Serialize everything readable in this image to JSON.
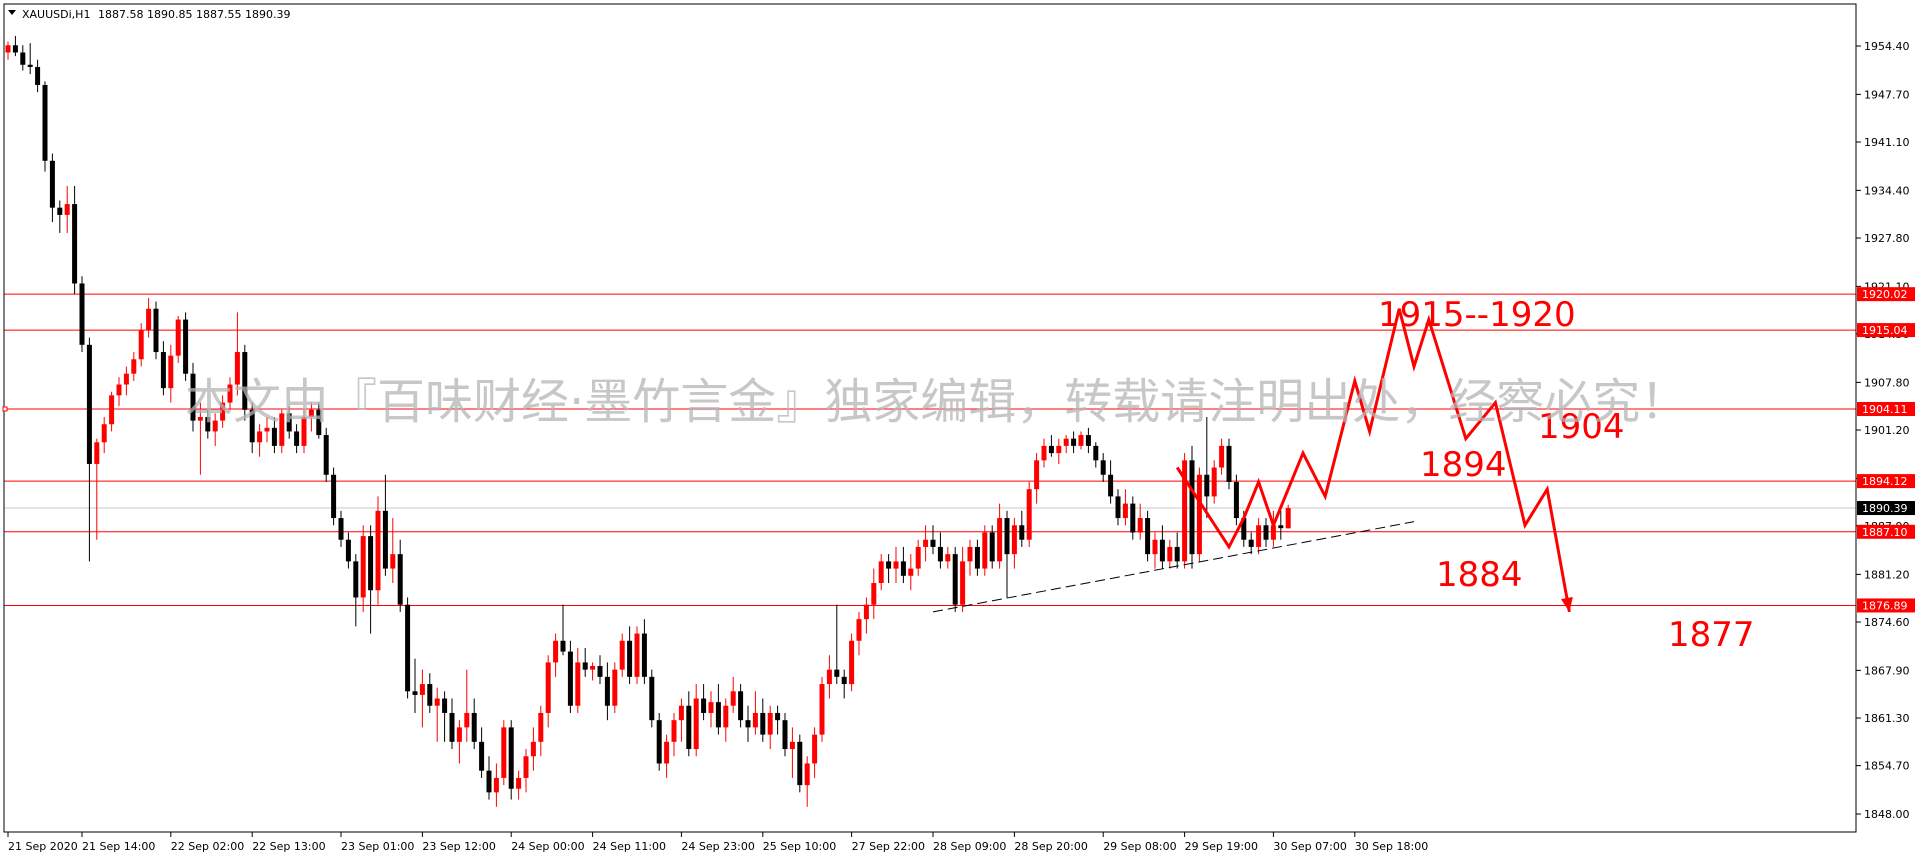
{
  "header": {
    "symbol": "XAUUSDi,H1",
    "ohlc": "1887.58 1890.85 1887.55 1890.39"
  },
  "watermark": "本文由『百味财经·墨竹言金』独家编辑，转载请注明出处，经察必究！",
  "chart_data": {
    "type": "candlestick",
    "symbol": "XAUUSDi",
    "timeframe": "H1",
    "ylim": [
      1845.0,
      1960.0
    ],
    "y_ticks": [
      1954.4,
      1947.7,
      1941.1,
      1934.4,
      1927.8,
      1921.1,
      1914.5,
      1907.8,
      1901.2,
      1894.5,
      1887.9,
      1881.2,
      1874.6,
      1867.9,
      1861.3,
      1854.7,
      1848.0
    ],
    "x_ticks": [
      "21 Sep 2020",
      "21 Sep 14:00",
      "22 Sep 02:00",
      "22 Sep 13:00",
      "23 Sep 01:00",
      "23 Sep 12:00",
      "24 Sep 00:00",
      "24 Sep 11:00",
      "24 Sep 23:00",
      "25 Sep 10:00",
      "27 Sep 22:00",
      "28 Sep 09:00",
      "28 Sep 20:00",
      "29 Sep 08:00",
      "29 Sep 19:00",
      "30 Sep 07:00",
      "30 Sep 18:00"
    ],
    "x_tick_index": [
      0,
      10,
      22,
      33,
      45,
      56,
      68,
      79,
      91,
      102,
      114,
      125,
      136,
      148,
      159,
      171,
      182
    ],
    "candles_approx": [
      [
        1953.5,
        1955.0,
        1952.5,
        1954.5
      ],
      [
        1954.5,
        1955.8,
        1953.0,
        1953.5
      ],
      [
        1953.5,
        1954.5,
        1951.0,
        1951.8
      ],
      [
        1951.8,
        1954.8,
        1950.5,
        1951.5
      ],
      [
        1951.5,
        1952.5,
        1948.0,
        1949.0
      ],
      [
        1949.0,
        1949.5,
        1937.0,
        1938.5
      ],
      [
        1938.5,
        1939.5,
        1930.0,
        1932.0
      ],
      [
        1932.0,
        1933.0,
        1928.5,
        1931.0
      ],
      [
        1931.0,
        1935.0,
        1928.5,
        1932.5
      ],
      [
        1932.5,
        1935.0,
        1920.0,
        1921.5
      ],
      [
        1921.5,
        1922.5,
        1912.0,
        1913.0
      ],
      [
        1913.0,
        1914.0,
        1883.0,
        1896.5
      ],
      [
        1896.5,
        1900.0,
        1886.0,
        1899.5
      ],
      [
        1899.5,
        1903.0,
        1898.0,
        1902.0
      ],
      [
        1902.0,
        1906.5,
        1901.0,
        1906.0
      ],
      [
        1906.0,
        1908.5,
        1904.5,
        1907.5
      ],
      [
        1907.5,
        1910.0,
        1906.0,
        1909.0
      ],
      [
        1909.0,
        1912.0,
        1908.0,
        1911.0
      ],
      [
        1911.0,
        1916.0,
        1910.0,
        1915.0
      ],
      [
        1915.0,
        1919.5,
        1914.0,
        1918.0
      ],
      [
        1918.0,
        1919.0,
        1911.0,
        1912.0
      ],
      [
        1912.0,
        1913.5,
        1906.0,
        1907.0
      ],
      [
        1907.0,
        1913.0,
        1905.0,
        1911.5
      ],
      [
        1911.5,
        1917.0,
        1910.5,
        1916.5
      ],
      [
        1916.5,
        1917.5,
        1908.0,
        1909.0
      ],
      [
        1909.0,
        1910.5,
        1901.0,
        1902.5
      ],
      [
        1902.5,
        1905.0,
        1895.0,
        1903.0
      ],
      [
        1903.0,
        1904.0,
        1900.0,
        1901.0
      ],
      [
        1901.0,
        1903.5,
        1899.0,
        1902.5
      ],
      [
        1902.5,
        1906.0,
        1901.5,
        1905.0
      ],
      [
        1905.0,
        1908.5,
        1904.0,
        1907.5
      ],
      [
        1907.5,
        1917.5,
        1906.0,
        1912.0
      ],
      [
        1912.0,
        1913.0,
        1902.5,
        1904.0
      ],
      [
        1904.0,
        1905.0,
        1898.0,
        1899.5
      ],
      [
        1899.5,
        1902.0,
        1897.5,
        1901.0
      ],
      [
        1901.0,
        1903.0,
        1899.5,
        1901.5
      ],
      [
        1901.5,
        1903.0,
        1898.0,
        1899.0
      ],
      [
        1899.0,
        1904.0,
        1898.0,
        1903.5
      ],
      [
        1903.5,
        1904.5,
        1900.0,
        1901.0
      ],
      [
        1901.0,
        1902.0,
        1898.0,
        1899.0
      ],
      [
        1899.0,
        1904.0,
        1898.0,
        1903.0
      ],
      [
        1903.0,
        1905.0,
        1901.0,
        1904.0
      ],
      [
        1904.0,
        1905.0,
        1900.0,
        1900.5
      ],
      [
        1900.5,
        1901.5,
        1894.0,
        1895.0
      ],
      [
        1895.0,
        1896.0,
        1888.0,
        1889.0
      ],
      [
        1889.0,
        1890.0,
        1885.0,
        1886.0
      ],
      [
        1886.0,
        1887.0,
        1882.0,
        1883.0
      ],
      [
        1883.0,
        1884.0,
        1874.0,
        1878.0
      ],
      [
        1878.0,
        1888.0,
        1876.0,
        1886.5
      ],
      [
        1886.5,
        1888.0,
        1873.0,
        1879.0
      ],
      [
        1879.0,
        1892.0,
        1877.0,
        1890.0
      ],
      [
        1890.0,
        1895.0,
        1881.0,
        1882.0
      ],
      [
        1882.0,
        1889.0,
        1880.0,
        1884.0
      ],
      [
        1884.0,
        1886.0,
        1876.0,
        1877.0
      ],
      [
        1877.0,
        1878.0,
        1864.0,
        1865.0
      ],
      [
        1865.0,
        1869.5,
        1862.0,
        1864.5
      ],
      [
        1864.5,
        1868.0,
        1860.0,
        1866.0
      ],
      [
        1866.0,
        1867.5,
        1862.0,
        1863.0
      ],
      [
        1863.0,
        1865.5,
        1858.0,
        1864.0
      ],
      [
        1864.0,
        1865.0,
        1858.0,
        1862.0
      ],
      [
        1862.0,
        1864.0,
        1857.0,
        1858.0
      ],
      [
        1858.0,
        1861.0,
        1855.0,
        1860.0
      ],
      [
        1860.0,
        1868.0,
        1858.0,
        1862.0
      ],
      [
        1862.0,
        1864.0,
        1857.0,
        1858.0
      ],
      [
        1858.0,
        1860.0,
        1853.0,
        1854.0
      ],
      [
        1854.0,
        1856.0,
        1850.0,
        1851.0
      ],
      [
        1851.0,
        1855.0,
        1849.0,
        1853.0
      ],
      [
        1853.0,
        1861.0,
        1852.0,
        1860.0
      ],
      [
        1860.0,
        1861.0,
        1850.0,
        1851.5
      ],
      [
        1851.5,
        1854.0,
        1850.0,
        1853.0
      ],
      [
        1853.0,
        1857.0,
        1851.0,
        1856.0
      ],
      [
        1856.0,
        1860.0,
        1854.0,
        1858.0
      ],
      [
        1858.0,
        1863.0,
        1856.0,
        1862.0
      ],
      [
        1862.0,
        1870.0,
        1860.0,
        1869.0
      ],
      [
        1869.0,
        1873.0,
        1867.0,
        1872.0
      ],
      [
        1872.0,
        1877.0,
        1870.0,
        1870.5
      ],
      [
        1870.5,
        1872.0,
        1862.0,
        1863.0
      ],
      [
        1863.0,
        1871.0,
        1862.0,
        1869.0
      ],
      [
        1869.0,
        1871.0,
        1867.0,
        1868.0
      ],
      [
        1868.0,
        1869.0,
        1866.5,
        1868.5
      ],
      [
        1868.5,
        1870.0,
        1866.0,
        1867.0
      ],
      [
        1867.0,
        1869.0,
        1861.0,
        1863.0
      ],
      [
        1863.0,
        1869.0,
        1862.0,
        1868.0
      ],
      [
        1868.0,
        1873.0,
        1867.0,
        1872.0
      ],
      [
        1872.0,
        1874.0,
        1866.0,
        1867.0
      ],
      [
        1867.0,
        1874.0,
        1866.0,
        1873.0
      ],
      [
        1873.0,
        1875.0,
        1866.0,
        1867.0
      ],
      [
        1867.0,
        1868.0,
        1860.0,
        1861.0
      ],
      [
        1861.0,
        1862.0,
        1854.0,
        1855.0
      ],
      [
        1855.0,
        1859.0,
        1853.0,
        1858.0
      ],
      [
        1858.0,
        1862.0,
        1856.0,
        1861.0
      ],
      [
        1861.0,
        1864.0,
        1858.0,
        1863.0
      ],
      [
        1863.0,
        1865.0,
        1856.0,
        1857.0
      ],
      [
        1857.0,
        1866.0,
        1856.0,
        1864.0
      ],
      [
        1864.0,
        1866.0,
        1861.0,
        1862.0
      ],
      [
        1862.0,
        1865.0,
        1860.0,
        1863.5
      ],
      [
        1863.5,
        1866.0,
        1859.0,
        1860.0
      ],
      [
        1860.0,
        1864.0,
        1858.0,
        1863.0
      ],
      [
        1863.0,
        1867.0,
        1862.0,
        1865.0
      ],
      [
        1865.0,
        1866.0,
        1860.0,
        1861.0
      ],
      [
        1861.0,
        1863.0,
        1858.0,
        1860.0
      ],
      [
        1860.0,
        1865.0,
        1859.0,
        1862.0
      ],
      [
        1862.0,
        1864.0,
        1858.0,
        1859.0
      ],
      [
        1859.0,
        1863.0,
        1857.0,
        1862.0
      ],
      [
        1862.0,
        1863.0,
        1859.0,
        1861.0
      ],
      [
        1861.0,
        1862.0,
        1856.0,
        1857.0
      ],
      [
        1857.0,
        1860.0,
        1853.0,
        1858.0
      ],
      [
        1858.0,
        1859.0,
        1851.0,
        1852.0
      ],
      [
        1852.0,
        1856.0,
        1849.0,
        1855.0
      ],
      [
        1855.0,
        1860.0,
        1853.0,
        1859.0
      ],
      [
        1859.0,
        1867.0,
        1858.0,
        1866.0
      ],
      [
        1866.0,
        1870.0,
        1864.0,
        1868.0
      ],
      [
        1868.0,
        1877.0,
        1866.0,
        1867.0
      ],
      [
        1867.0,
        1868.0,
        1864.0,
        1866.0
      ],
      [
        1866.0,
        1873.0,
        1865.0,
        1872.0
      ],
      [
        1872.0,
        1876.0,
        1870.0,
        1875.0
      ],
      [
        1875.0,
        1878.0,
        1873.0,
        1877.0
      ],
      [
        1877.0,
        1882.0,
        1875.0,
        1880.0
      ],
      [
        1880.0,
        1884.0,
        1879.0,
        1883.0
      ],
      [
        1883.0,
        1884.0,
        1880.0,
        1882.0
      ],
      [
        1882.0,
        1885.0,
        1880.0,
        1883.0
      ],
      [
        1883.0,
        1885.0,
        1880.0,
        1881.0
      ],
      [
        1881.0,
        1884.0,
        1879.0,
        1882.0
      ],
      [
        1882.0,
        1886.0,
        1881.0,
        1885.0
      ],
      [
        1885.0,
        1888.0,
        1883.0,
        1886.0
      ],
      [
        1886.0,
        1888.0,
        1884.0,
        1885.0
      ],
      [
        1885.0,
        1887.0,
        1882.0,
        1883.0
      ],
      [
        1883.0,
        1885.0,
        1882.0,
        1884.0
      ],
      [
        1884.0,
        1885.0,
        1876.0,
        1877.0
      ],
      [
        1877.0,
        1885.0,
        1876.0,
        1883.0
      ],
      [
        1883.0,
        1886.0,
        1881.0,
        1885.0
      ],
      [
        1885.0,
        1886.0,
        1881.0,
        1882.0
      ],
      [
        1882.0,
        1888.0,
        1881.0,
        1887.0
      ],
      [
        1887.0,
        1888.0,
        1882.0,
        1883.0
      ],
      [
        1883.0,
        1891.0,
        1882.0,
        1889.0
      ],
      [
        1889.0,
        1890.0,
        1878.0,
        1884.0
      ],
      [
        1884.0,
        1889.0,
        1882.0,
        1888.0
      ],
      [
        1888.0,
        1890.0,
        1885.0,
        1886.0
      ],
      [
        1886.0,
        1894.0,
        1885.0,
        1893.0
      ],
      [
        1893.0,
        1898.0,
        1891.0,
        1897.0
      ],
      [
        1897.0,
        1900.0,
        1896.0,
        1899.0
      ],
      [
        1899.0,
        1900.5,
        1897.5,
        1898.0
      ],
      [
        1898.0,
        1900.0,
        1896.5,
        1899.0
      ],
      [
        1899.0,
        1900.5,
        1898.0,
        1900.0
      ],
      [
        1900.0,
        1901.0,
        1898.0,
        1899.0
      ],
      [
        1899.0,
        1901.0,
        1898.5,
        1900.5
      ],
      [
        1900.5,
        1901.5,
        1898.0,
        1899.0
      ],
      [
        1899.0,
        1899.5,
        1896.0,
        1897.0
      ],
      [
        1897.0,
        1898.0,
        1894.0,
        1895.0
      ],
      [
        1895.0,
        1897.0,
        1891.0,
        1892.0
      ],
      [
        1892.0,
        1893.0,
        1888.0,
        1889.0
      ],
      [
        1889.0,
        1893.0,
        1888.0,
        1891.0
      ],
      [
        1891.0,
        1892.0,
        1886.0,
        1887.0
      ],
      [
        1887.0,
        1891.0,
        1886.0,
        1889.0
      ],
      [
        1889.0,
        1890.0,
        1883.0,
        1884.0
      ],
      [
        1884.0,
        1887.0,
        1882.0,
        1886.0
      ],
      [
        1886.0,
        1888.0,
        1882.0,
        1883.0
      ],
      [
        1883.0,
        1886.0,
        1882.0,
        1885.0
      ],
      [
        1885.0,
        1887.0,
        1882.0,
        1883.0
      ],
      [
        1883.0,
        1898.0,
        1882.0,
        1897.0
      ],
      [
        1897.0,
        1899.0,
        1882.0,
        1884.0
      ],
      [
        1884.0,
        1896.0,
        1883.0,
        1895.0
      ],
      [
        1895.0,
        1903.0,
        1889.0,
        1892.0
      ],
      [
        1892.0,
        1897.0,
        1891.0,
        1896.0
      ],
      [
        1896.0,
        1900.0,
        1895.0,
        1899.0
      ],
      [
        1899.0,
        1900.0,
        1893.0,
        1894.0
      ],
      [
        1894.0,
        1895.0,
        1888.0,
        1889.0
      ],
      [
        1889.0,
        1890.0,
        1885.0,
        1886.0
      ],
      [
        1886.0,
        1887.0,
        1884.0,
        1885.0
      ],
      [
        1885.0,
        1889.0,
        1884.0,
        1888.0
      ],
      [
        1888.0,
        1889.0,
        1885.0,
        1886.0
      ],
      [
        1886.0,
        1890.0,
        1885.0,
        1888.0
      ],
      [
        1888.0,
        1890.0,
        1886.0,
        1887.6
      ],
      [
        1887.58,
        1890.85,
        1887.55,
        1890.39
      ]
    ],
    "annotations": {
      "horizontal_levels": [
        1920.02,
        1915.04,
        1904.11,
        1894.12,
        1887.1,
        1876.89
      ],
      "bid_line": 1890.39,
      "level_labels": [
        "1920.02",
        "1915.04",
        "1904.11",
        "1894.12",
        "1887.10",
        "1876.89"
      ],
      "current_price_label": "1890.39",
      "text_labels": [
        "1915--1920",
        "1904",
        "1894",
        "1884",
        "1877"
      ],
      "trendline": [
        [
          125,
          1876.0
        ],
        [
          190,
          1888.5
        ]
      ],
      "forecast_path": [
        [
          158,
          1896.0
        ],
        [
          165,
          1885.0
        ],
        [
          167,
          1889.0
        ],
        [
          169,
          1894.0
        ],
        [
          171,
          1888.0
        ],
        [
          175,
          1898.0
        ],
        [
          178,
          1892.0
        ],
        [
          182,
          1908.0
        ],
        [
          184,
          1901.0
        ],
        [
          188,
          1918.0
        ],
        [
          190,
          1910.0
        ],
        [
          192,
          1916.5
        ],
        [
          197,
          1900.0
        ],
        [
          201,
          1905.0
        ],
        [
          205,
          1888.0
        ],
        [
          208,
          1893.0
        ],
        [
          211,
          1876.0
        ]
      ]
    },
    "colors": {
      "bull": "#ff0000",
      "bear": "#000000",
      "level_line": "#ff0000",
      "forecast": "#ff0000",
      "grid": "#c8c8c8",
      "axis_text": "#000000",
      "watermark": "#b4b4b4"
    }
  }
}
